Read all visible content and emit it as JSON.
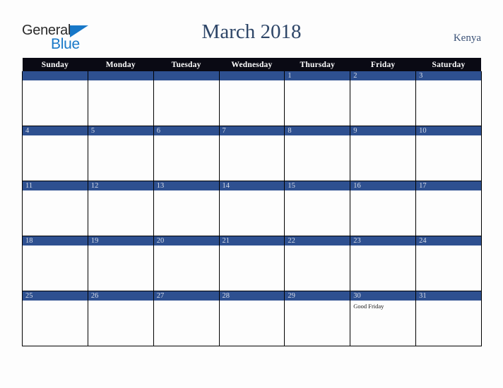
{
  "logo": {
    "word_one": "General",
    "word_two": "Blue",
    "triangle_icon": "triangle-icon",
    "brand_blue": "#1878c8",
    "brand_dark": "#2b2b2b"
  },
  "header": {
    "title": "March 2018",
    "region": "Kenya"
  },
  "colors": {
    "header_row": "#0a0a14",
    "date_bar": "#2e5090",
    "title_text": "#2e4668",
    "page_background": "#fdfdfd",
    "grid_line": "#000000"
  },
  "calendar": {
    "weekday_headers": [
      "Sunday",
      "Monday",
      "Tuesday",
      "Wednesday",
      "Thursday",
      "Friday",
      "Saturday"
    ],
    "weeks": [
      [
        {
          "date": "",
          "events": []
        },
        {
          "date": "",
          "events": []
        },
        {
          "date": "",
          "events": []
        },
        {
          "date": "",
          "events": []
        },
        {
          "date": "1",
          "events": []
        },
        {
          "date": "2",
          "events": []
        },
        {
          "date": "3",
          "events": []
        }
      ],
      [
        {
          "date": "4",
          "events": []
        },
        {
          "date": "5",
          "events": []
        },
        {
          "date": "6",
          "events": []
        },
        {
          "date": "7",
          "events": []
        },
        {
          "date": "8",
          "events": []
        },
        {
          "date": "9",
          "events": []
        },
        {
          "date": "10",
          "events": []
        }
      ],
      [
        {
          "date": "11",
          "events": []
        },
        {
          "date": "12",
          "events": []
        },
        {
          "date": "13",
          "events": []
        },
        {
          "date": "14",
          "events": []
        },
        {
          "date": "15",
          "events": []
        },
        {
          "date": "16",
          "events": []
        },
        {
          "date": "17",
          "events": []
        }
      ],
      [
        {
          "date": "18",
          "events": []
        },
        {
          "date": "19",
          "events": []
        },
        {
          "date": "20",
          "events": []
        },
        {
          "date": "21",
          "events": []
        },
        {
          "date": "22",
          "events": []
        },
        {
          "date": "23",
          "events": []
        },
        {
          "date": "24",
          "events": []
        }
      ],
      [
        {
          "date": "25",
          "events": []
        },
        {
          "date": "26",
          "events": []
        },
        {
          "date": "27",
          "events": []
        },
        {
          "date": "28",
          "events": []
        },
        {
          "date": "29",
          "events": []
        },
        {
          "date": "30",
          "events": [
            "Good Friday"
          ]
        },
        {
          "date": "31",
          "events": []
        }
      ]
    ]
  }
}
